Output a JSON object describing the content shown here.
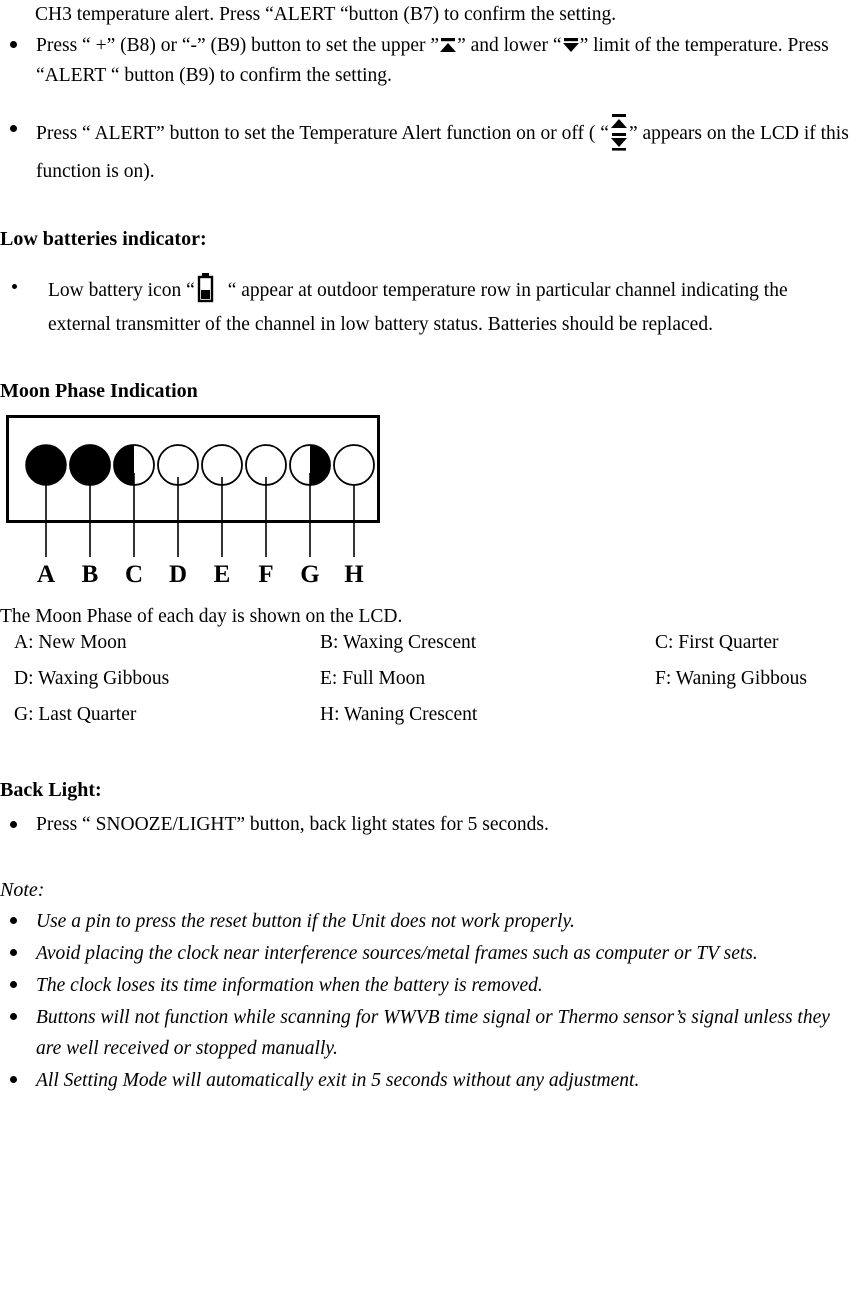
{
  "doc": {
    "continuation_line": "CH3 temperature alert. Press “ALERT “button (B7) to confirm the setting.",
    "alert_bullets": [
      {
        "pre": "Press “ +” (B8) or “-” (B9) button to set the upper ”",
        "mid": "” and lower “",
        "post": "” limit of the temperature. Press “ALERT “ button (B9) to confirm the setting.",
        "icon_upper": "upper-limit-icon",
        "icon_lower": "lower-limit-icon"
      },
      {
        "pre": "Press “ ALERT” button to set the Temperature Alert function on or off ( “",
        "post": "” appears on the LCD if this function is on).",
        "icon": "temperature-alert-range-icon"
      }
    ],
    "low_battery": {
      "heading": "Low batteries indicator:",
      "pre": "Low battery icon “",
      "post": "“ appear at outdoor temperature row in particular channel indicating the external transmitter of the channel in low battery status. Batteries should be replaced.",
      "icon": "low-battery-icon"
    },
    "moon": {
      "heading": "Moon Phase Indication",
      "caption": "The Moon Phase of each day is shown on the LCD.",
      "labels": [
        "A",
        "B",
        "C",
        "D",
        "E",
        "F",
        "G",
        "H"
      ],
      "phases": [
        {
          "letter": "A",
          "name": "New Moon",
          "type": "full-dark"
        },
        {
          "letter": "B",
          "name": "Waxing Crescent",
          "type": "dark-gibbous-right-light"
        },
        {
          "letter": "C",
          "name": "First Quarter",
          "type": "left-dark-half"
        },
        {
          "letter": "D",
          "name": "Waxing Gibbous",
          "type": "left-crescent-dark"
        },
        {
          "letter": "E",
          "name": "Full Moon",
          "type": "full-light"
        },
        {
          "letter": "F",
          "name": "Waning Gibbous",
          "type": "right-crescent-dark"
        },
        {
          "letter": "G",
          "name": "Last Quarter",
          "type": "right-dark-half"
        },
        {
          "letter": "H",
          "name": "Waning Crescent",
          "type": "dark-gibbous-left-light"
        }
      ],
      "legend_rows": [
        [
          "A: New Moon",
          "B: Waxing Crescent",
          "C: First Quarter"
        ],
        [
          "D: Waxing Gibbous",
          "E: Full Moon",
          "F: Waning Gibbous"
        ],
        [
          "G: Last Quarter",
          "H: Waning Crescent",
          ""
        ]
      ]
    },
    "back_light": {
      "heading": "Back Light:",
      "bullet": "Press “ SNOOZE/LIGHT” button, back light states for 5 seconds."
    },
    "note": {
      "title": "Note:",
      "bullets": [
        "Use a pin to press the reset button if the Unit does not work properly.",
        "Avoid placing the clock near interference sources/metal frames such as computer or TV sets.",
        "The clock loses its time information when the battery is removed.",
        "Buttons will not function while scanning for WWVB time signal or Thermo sensor’s signal unless they are well received or stopped manually.",
        "All Setting Mode will automatically exit in 5 seconds without any adjustment."
      ]
    },
    "colors": {
      "ink": "#000000",
      "paper": "#ffffff"
    }
  }
}
